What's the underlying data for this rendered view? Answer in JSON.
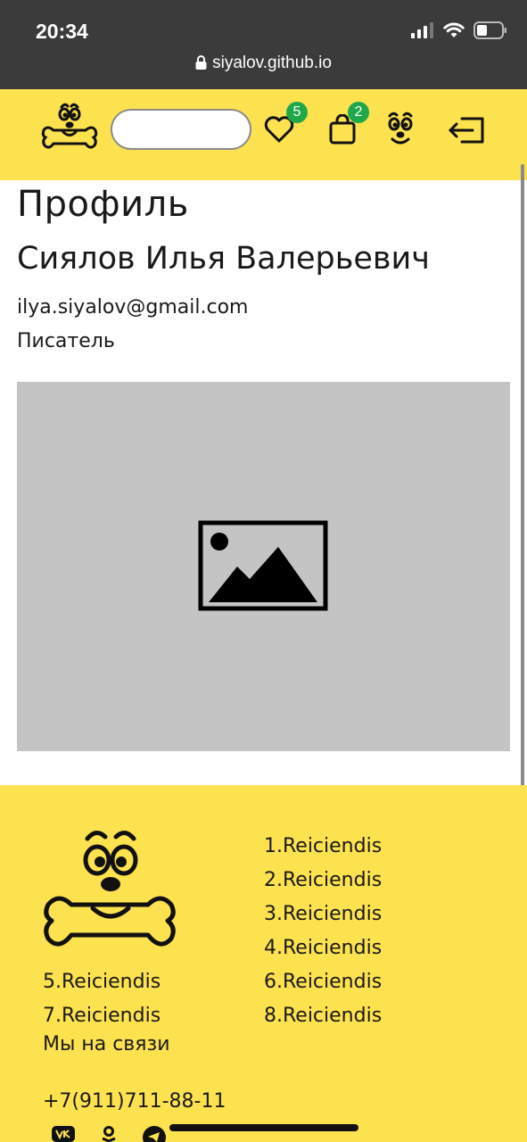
{
  "status_bar": {
    "time": "20:34",
    "url": "siyalov.github.io"
  },
  "header": {
    "search": {
      "placeholder": ""
    },
    "favorites_count": "5",
    "cart_count": "2"
  },
  "profile": {
    "title": "Профиль",
    "full_name": "Сиялов Илья Валерьевич",
    "email": "ilya.siyalov@gmail.com",
    "role": "Писатель"
  },
  "footer": {
    "links": [
      "1.Reiciendis",
      "2.Reiciendis",
      "3.Reiciendis",
      "4.Reiciendis",
      "5.Reiciendis",
      "6.Reiciendis",
      "7.Reiciendis",
      "8.Reiciendis"
    ],
    "contact_title": "Мы на связи",
    "phone": "+7(911)711-88-11",
    "social_icons": [
      "vk-icon",
      "odnoklassniki-icon",
      "telegram-icon"
    ]
  },
  "colors": {
    "brand_yellow": "#fde24f",
    "badge_green": "#1ea84a",
    "photo_placeholder": "#c4c4c4"
  }
}
